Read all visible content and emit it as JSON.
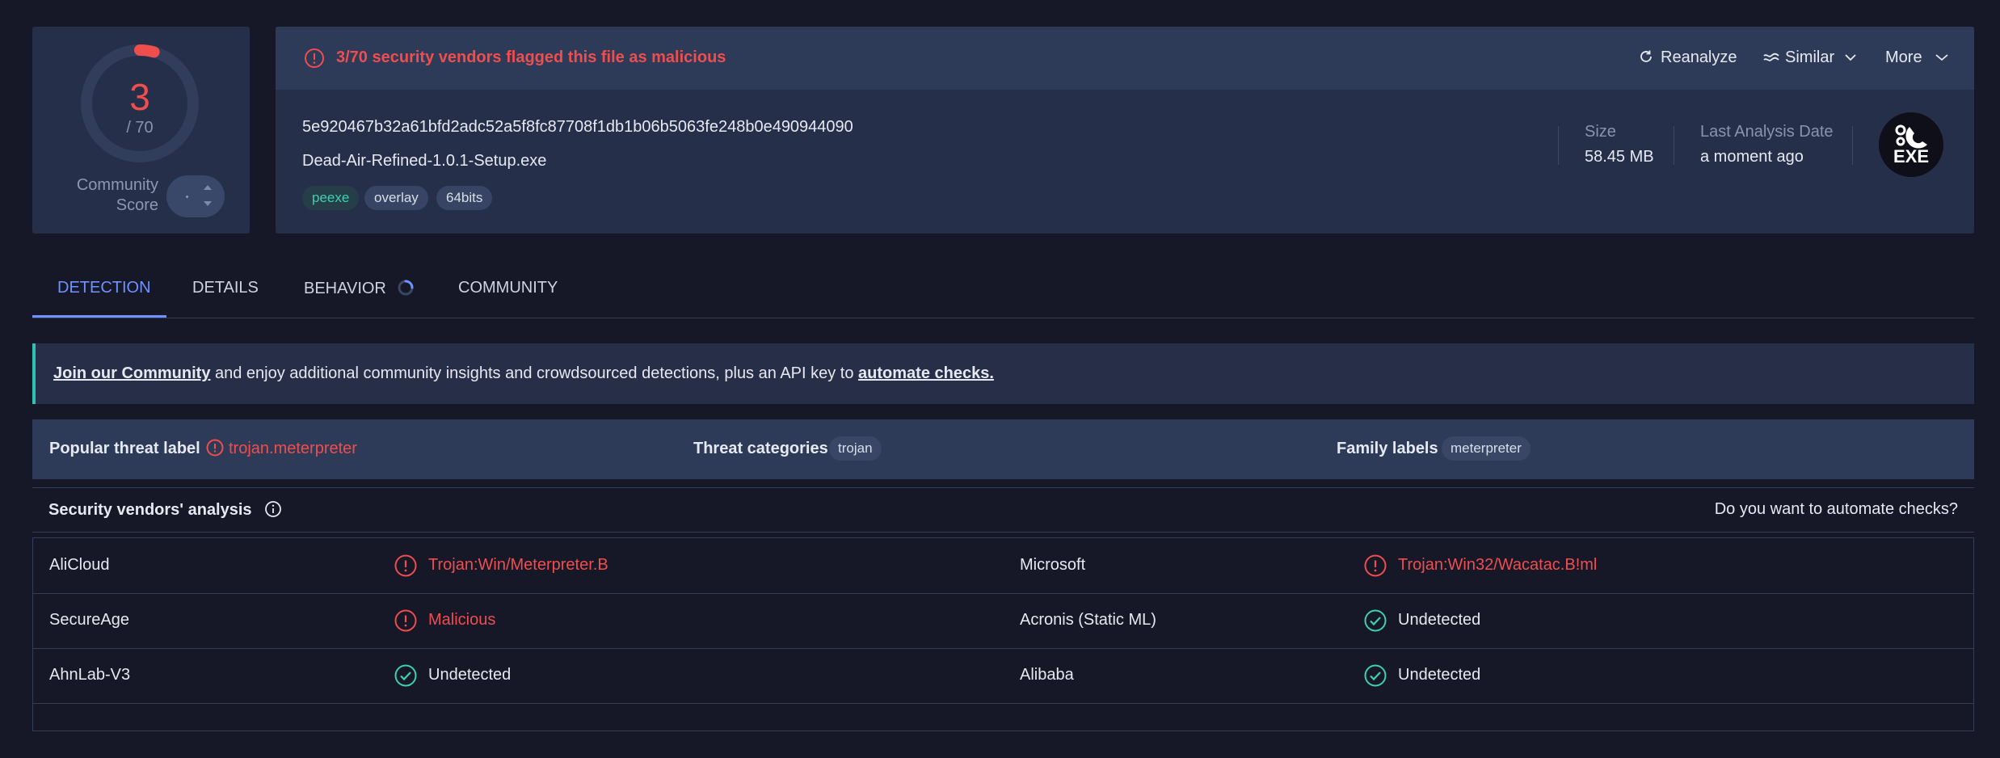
{
  "score": {
    "detections": "3",
    "total": "/ 70",
    "fraction_flagged": 0.0429,
    "community_label_line1": "Community",
    "community_label_line2": "Score"
  },
  "summary": {
    "alert": "3/70 security vendors flagged this file as malicious",
    "actions": {
      "reanalyze": "Reanalyze",
      "similar": "Similar",
      "more": "More"
    },
    "hash": "5e920467b32a61bfd2adc52a5f8fc87708f1db1b06b5063fe248b0e490944090",
    "filename": "Dead-Air-Refined-1.0.1-Setup.exe",
    "tags": [
      "peexe",
      "overlay",
      "64bits"
    ],
    "size_label": "Size",
    "size_value": "58.45 MB",
    "last_analysis_label": "Last Analysis Date",
    "last_analysis_value": "a moment ago",
    "file_type": "EXE"
  },
  "tabs": [
    "DETECTION",
    "DETAILS",
    "BEHAVIOR",
    "COMMUNITY"
  ],
  "banner": {
    "link1": "Join our Community",
    "middle": " and enjoy additional community insights and crowdsourced detections, plus an API key to ",
    "link2": "automate checks."
  },
  "threat": {
    "popular_label": "Popular threat label",
    "popular_value": "trojan.meterpreter",
    "categories_label": "Threat categories",
    "categories_value": "trojan",
    "family_label": "Family labels",
    "family_value": "meterpreter"
  },
  "vendors": {
    "title": "Security vendors' analysis",
    "automate": "Do you want to automate checks?",
    "rows": [
      {
        "left_name": "AliCloud",
        "left_result": "Trojan:Win/Meterpreter.B",
        "left_status": "malicious",
        "right_name": "Microsoft",
        "right_result": "Trojan:Win32/Wacatac.B!ml",
        "right_status": "malicious"
      },
      {
        "left_name": "SecureAge",
        "left_result": "Malicious",
        "left_status": "malicious",
        "right_name": "Acronis (Static ML)",
        "right_result": "Undetected",
        "right_status": "undetected"
      },
      {
        "left_name": "AhnLab-V3",
        "left_result": "Undetected",
        "left_status": "undetected",
        "right_name": "Alibaba",
        "right_result": "Undetected",
        "right_status": "undetected"
      }
    ]
  },
  "colors": {
    "malicious": "#ef4e4e",
    "clean": "#3ed1b0",
    "accent": "#6f92ff",
    "panel": "#262f4a"
  }
}
